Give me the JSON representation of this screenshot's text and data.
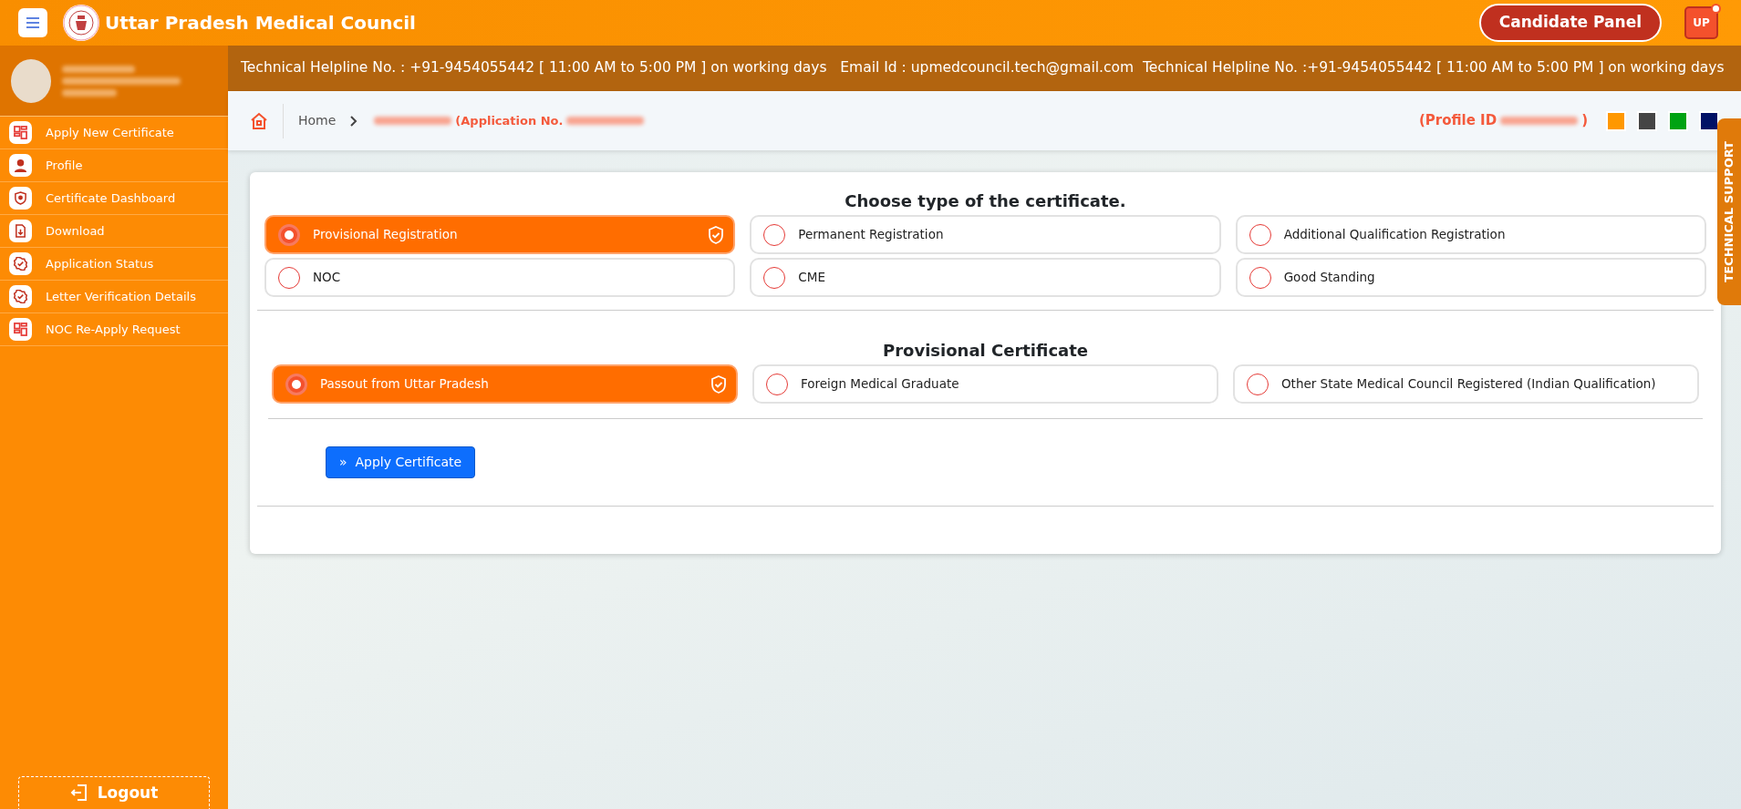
{
  "header": {
    "title": "Uttar Pradesh Medical Council",
    "panel_button": "Candidate Panel",
    "user_badge": "UP"
  },
  "sidebar": {
    "items": [
      {
        "label": "Apply New Certificate",
        "kind": "grid"
      },
      {
        "label": "Profile",
        "kind": "person"
      },
      {
        "label": "Certificate Dashboard",
        "kind": "shield"
      },
      {
        "label": "Download",
        "kind": "file"
      },
      {
        "label": "Application Status",
        "kind": "check"
      },
      {
        "label": "Letter Verification Details",
        "kind": "check"
      },
      {
        "label": "NOC Re-Apply Request",
        "kind": "grid"
      }
    ],
    "logout": "Logout"
  },
  "ticker": "Technical Helpline No. : +91-9454055442 [ 11:00 AM to 5:00 PM ] on working days   Email Id : upmedcouncil.tech@gmail.com  Technical Helpline No. :+91-9454055442 [ 11:00 AM to 5:00 PM ] on working days",
  "breadcrumb": {
    "home": "Home",
    "application": "(Application No.",
    "profile": "(Profile ID",
    "profile_end": ")"
  },
  "theme_swatches": [
    {
      "color": "#ff9800"
    },
    {
      "color": "#454545"
    },
    {
      "color": "#00a313"
    },
    {
      "color": "#001166"
    }
  ],
  "side_tab": "TECHNICAL SUPPORT",
  "certificate_type": {
    "title": "Choose type of the certificate.",
    "options": [
      {
        "label": "Provisional Registration",
        "selected": true
      },
      {
        "label": "Permanent Registration",
        "selected": false
      },
      {
        "label": "Additional Qualification Registration",
        "selected": false
      },
      {
        "label": "NOC",
        "selected": false
      },
      {
        "label": "CME",
        "selected": false
      },
      {
        "label": "Good Standing",
        "selected": false
      }
    ]
  },
  "provisional": {
    "title": "Provisional Certificate",
    "options": [
      {
        "label": "Passout from Uttar Pradesh",
        "selected": true
      },
      {
        "label": "Foreign Medical Graduate",
        "selected": false
      },
      {
        "label": "Other State Medical Council Registered (Indian Qualification)",
        "selected": false
      }
    ]
  },
  "apply_button": {
    "icon": "»",
    "label": "Apply Certificate"
  }
}
